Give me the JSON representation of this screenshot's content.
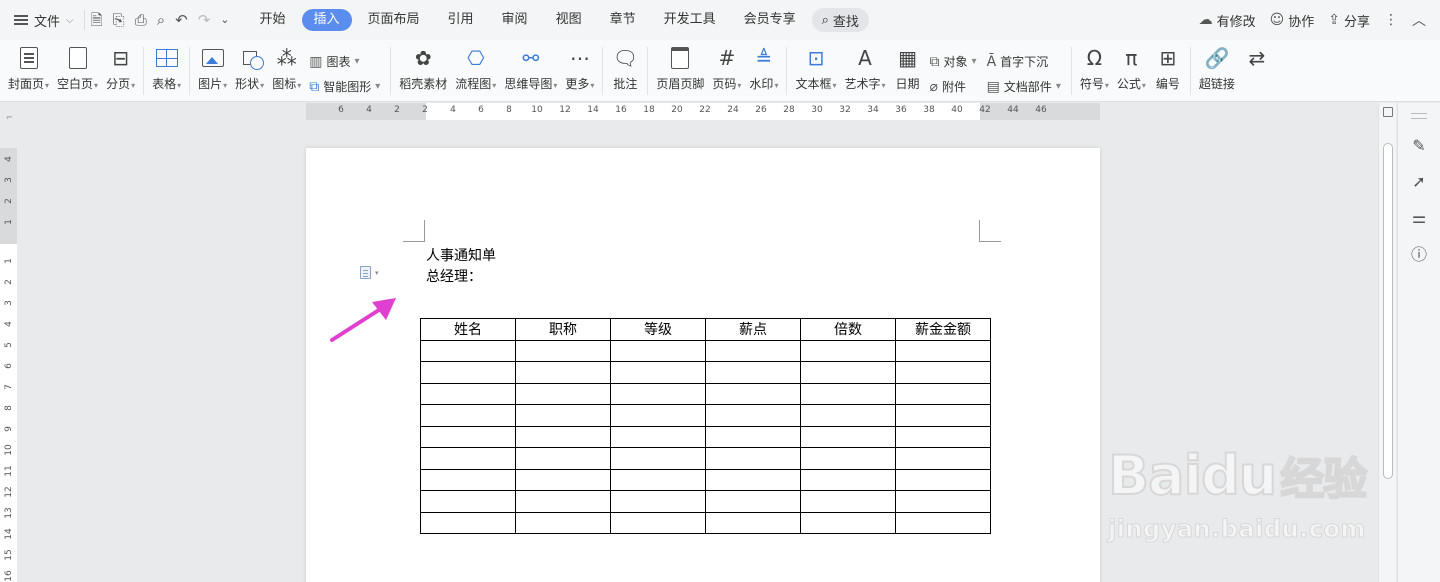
{
  "menubar": {
    "file_label": "文件",
    "tabs": [
      {
        "label": "开始",
        "active": false
      },
      {
        "label": "插入",
        "active": true
      },
      {
        "label": "页面布局",
        "active": false
      },
      {
        "label": "引用",
        "active": false
      },
      {
        "label": "审阅",
        "active": false
      },
      {
        "label": "视图",
        "active": false
      },
      {
        "label": "章节",
        "active": false
      },
      {
        "label": "开发工具",
        "active": false
      },
      {
        "label": "会员专享",
        "active": false
      }
    ],
    "search_label": "查找",
    "right": {
      "modified": "有修改",
      "collab": "协作",
      "share": "分享"
    }
  },
  "ribbon": {
    "cover_page": "封面页",
    "blank_page": "空白页",
    "page_break": "分页",
    "table": "表格",
    "picture": "图片",
    "shape": "形状",
    "icon": "图标",
    "chart": "图表",
    "smart_graphic": "智能图形",
    "docer_material": "稻壳素材",
    "flowchart": "流程图",
    "mindmap": "思维导图",
    "more": "更多",
    "comment": "批注",
    "header_footer": "页眉页脚",
    "page_number": "页码",
    "watermark": "水印",
    "textbox": "文本框",
    "wordart": "艺术字",
    "date": "日期",
    "object": "对象",
    "attachment": "附件",
    "drop_cap": "首字下沉",
    "doc_parts": "文档部件",
    "symbol": "符号",
    "formula": "公式",
    "numbering": "编号",
    "hyperlink": "超链接"
  },
  "ruler": {
    "h_numbers": [
      "6",
      "4",
      "2",
      "2",
      "4",
      "6",
      "8",
      "10",
      "12",
      "14",
      "16",
      "18",
      "20",
      "22",
      "24",
      "26",
      "28",
      "30",
      "32",
      "34",
      "36",
      "38",
      "40",
      "42",
      "44",
      "46"
    ],
    "v_numbers_top": [
      "4",
      "3",
      "2",
      "1"
    ],
    "v_numbers": [
      "1",
      "2",
      "3",
      "4",
      "5",
      "6",
      "7",
      "8",
      "9",
      "10",
      "11",
      "12",
      "13",
      "14",
      "15",
      "16"
    ]
  },
  "document": {
    "title": "人事通知单",
    "line2": "总经理：",
    "table": {
      "headers": [
        "姓名",
        "职称",
        "等级",
        "薪点",
        "倍数",
        "薪金金额"
      ],
      "empty_rows": 9
    }
  },
  "watermark": {
    "big": "Bai",
    "big2": "du",
    "cn": "经验",
    "url": "jingyan.baidu.com"
  },
  "colors": {
    "accent": "#5b8def",
    "arrow": "#e040d0"
  }
}
